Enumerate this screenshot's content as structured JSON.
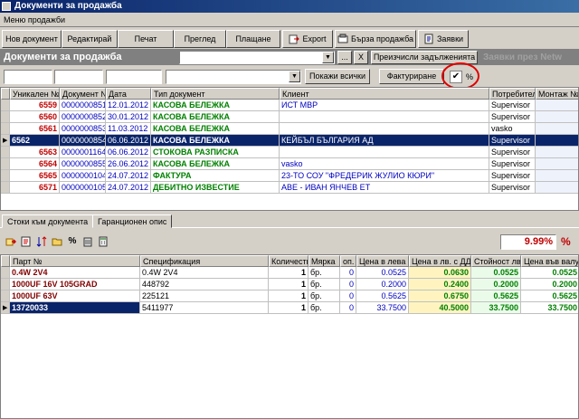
{
  "window": {
    "title": "Документи за продажба"
  },
  "menu": {
    "item": "Меню продажби"
  },
  "toolbar": {
    "new_doc": "Нов документ",
    "edit": "Редактирай",
    "print": "Печат",
    "preview": "Преглед",
    "payments": "Плащане",
    "export": "Export",
    "quick_sale": "Бърза продажба",
    "requests": "Заявки"
  },
  "section": {
    "title": "Документи за продажба",
    "recalc_btn": "Преизчисли задълженията",
    "ghost_title": "Заявки през Netw"
  },
  "filters": {
    "show_all": "Покажи всички",
    "invoice": "Фактуриране",
    "percent_label": "%",
    "checkbox_mark": "✔",
    "close_mark": "X",
    "dots_mark": "..."
  },
  "docs_table": {
    "headers": [
      "Уникален №",
      "Документ №",
      "Дата",
      "Тип документ",
      "Клиент",
      "Потребител",
      "Монтаж №"
    ],
    "rows": [
      {
        "id": "6559",
        "doc": "0000000851",
        "date": "12.01.2012",
        "type": "КАСОВА БЕЛЕЖКА",
        "client": "ИСТ МВР",
        "user": "Supervisor",
        "mount": ""
      },
      {
        "id": "6560",
        "doc": "0000000852",
        "date": "30.01.2012",
        "type": "КАСОВА БЕЛЕЖКА",
        "client": "",
        "user": "Supervisor",
        "mount": ""
      },
      {
        "id": "6561",
        "doc": "0000000853",
        "date": "11.03.2012",
        "type": "КАСОВА БЕЛЕЖКА",
        "client": "",
        "user": "vasko",
        "mount": ""
      },
      {
        "id": "6562",
        "doc": "0000000854",
        "date": "06.06.2012",
        "type": "КАСОВА БЕЛЕЖКА",
        "client": "КЕЙБЪЛ БЪЛГАРИЯ АД",
        "user": "Supervisor",
        "mount": ""
      },
      {
        "id": "6563",
        "doc": "0000001164",
        "date": "06.06.2012",
        "type": "СТОКОВА РАЗПИСКА",
        "client": "",
        "user": "Supervisor",
        "mount": ""
      },
      {
        "id": "6564",
        "doc": "0000000855",
        "date": "26.06.2012",
        "type": "КАСОВА БЕЛЕЖКА",
        "client": "vasko",
        "user": "Supervisor",
        "mount": ""
      },
      {
        "id": "6565",
        "doc": "0000000104",
        "date": "24.07.2012",
        "type": "ФАКТУРА",
        "client": "23-ТО СОУ \"ФРЕДЕРИК ЖУЛИО КЮРИ\"",
        "user": "Supervisor",
        "mount": ""
      },
      {
        "id": "6571",
        "doc": "0000000105",
        "date": "24.07.2012",
        "type": "ДЕБИТНО ИЗВЕСТИЕ",
        "client": "АВЕ - ИВАН ЯНЧЕВ ЕТ",
        "user": "Supervisor",
        "mount": ""
      }
    ]
  },
  "tabs": {
    "goods": "Стоки към документа",
    "warranty": "Гаранционен опис"
  },
  "discount": {
    "value": "9.99%",
    "sign": "%"
  },
  "goods_table": {
    "headers": [
      "Парт №",
      "Спецификация",
      "Количество",
      "Мярка",
      "оп.",
      "Цена в лева",
      "Цена в лв. с ДДС",
      "Стойност лв.",
      "Цена във валута"
    ],
    "rows": [
      {
        "part": "0.4W 2V4",
        "spec": "0.4W 2V4",
        "qty": "1",
        "unit": "бр.",
        "op": "0",
        "price": "0.0525",
        "price_vat": "0.0630",
        "value": "0.0525",
        "fx": "0.0525"
      },
      {
        "part": "1000UF 16V 105GRAD",
        "spec": "448792",
        "qty": "1",
        "unit": "бр.",
        "op": "0",
        "price": "0.2000",
        "price_vat": "0.2400",
        "value": "0.2000",
        "fx": "0.2000"
      },
      {
        "part": "1000UF 63V",
        "spec": "225121",
        "qty": "1",
        "unit": "бр.",
        "op": "0",
        "price": "0.5625",
        "price_vat": "0.6750",
        "value": "0.5625",
        "fx": "0.5625"
      },
      {
        "part": "13720033",
        "spec": "5411977",
        "qty": "1",
        "unit": "бр.",
        "op": "0",
        "price": "33.7500",
        "price_vat": "40.5000",
        "value": "33.7500",
        "fx": "33.7500"
      }
    ]
  }
}
